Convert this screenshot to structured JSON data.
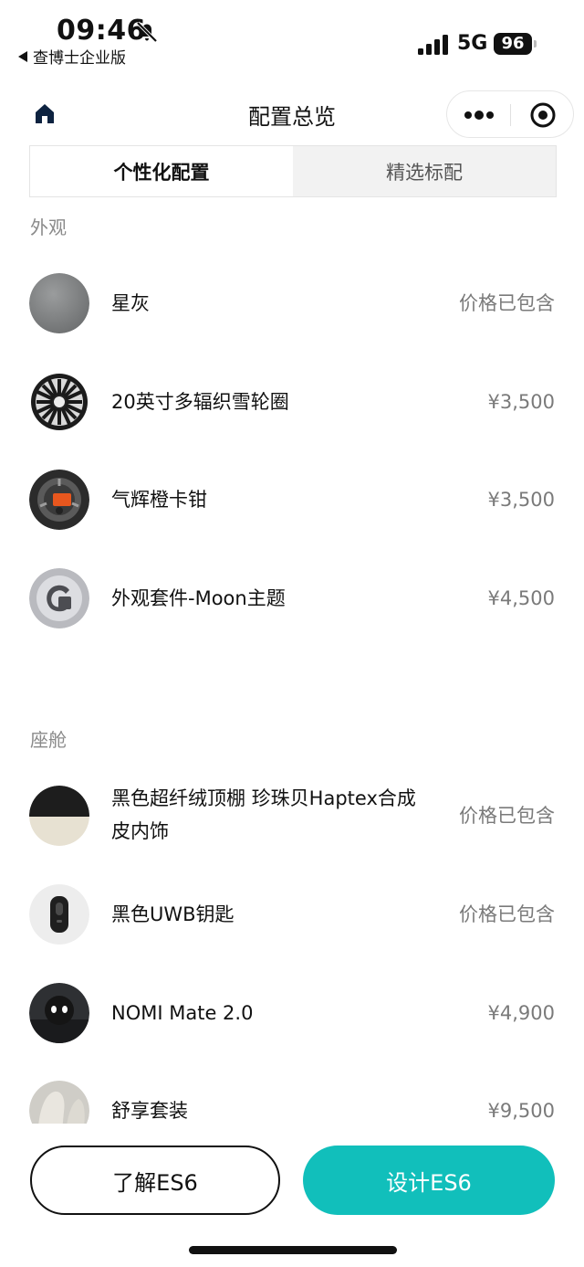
{
  "status_bar": {
    "time": "09:46",
    "back_app": "查博士企业版",
    "network": "5G",
    "battery": "96"
  },
  "nav": {
    "title": "配置总览"
  },
  "tabs": [
    {
      "label": "个性化配置",
      "active": true
    },
    {
      "label": "精选标配",
      "active": false
    }
  ],
  "sections": {
    "exterior": {
      "title": "外观",
      "items": [
        {
          "name": "星灰",
          "price": "价格已包含",
          "icon": "gray-paint-swatch"
        },
        {
          "name": "20英寸多辐织雪轮圈",
          "price": "¥3,500",
          "icon": "wheel-rim"
        },
        {
          "name": "气辉橙卡钳",
          "price": "¥3,500",
          "icon": "orange-caliper"
        },
        {
          "name": "外观套件-Moon主题",
          "price": "¥4,500",
          "icon": "moon-kit"
        }
      ]
    },
    "cabin": {
      "title": "座舱",
      "items": [
        {
          "name_line1": "黑色超纤绒顶棚 珍珠贝Haptex合成",
          "name_line2": "皮内饰",
          "price": "价格已包含",
          "icon": "interior-swatch"
        },
        {
          "name": "黑色UWB钥匙",
          "price": "价格已包含",
          "icon": "uwb-key"
        },
        {
          "name": "NOMI Mate 2.0",
          "price": "¥4,900",
          "icon": "nomi-mate"
        },
        {
          "name": "舒享套装",
          "price": "¥9,500",
          "icon": "seat-package"
        }
      ]
    }
  },
  "buttons": {
    "learn": "了解ES6",
    "design": "设计ES6"
  },
  "colors": {
    "accent": "#11bfbb",
    "caliper": "#e8571e"
  }
}
